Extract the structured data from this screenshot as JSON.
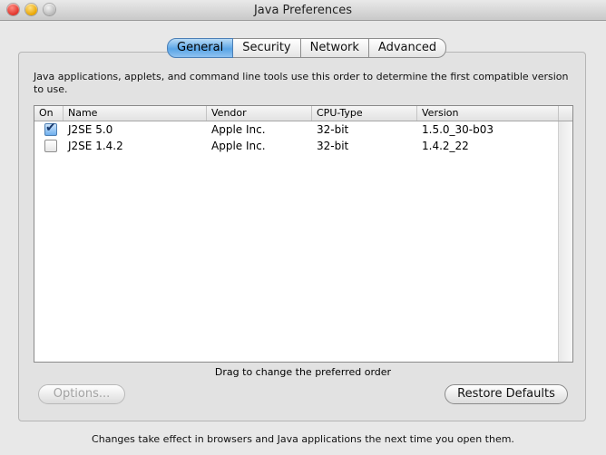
{
  "window": {
    "title": "Java Preferences"
  },
  "tabs": [
    {
      "label": "General",
      "active": true
    },
    {
      "label": "Security",
      "active": false
    },
    {
      "label": "Network",
      "active": false
    },
    {
      "label": "Advanced",
      "active": false
    }
  ],
  "description": "Java applications, applets, and command line tools use this order to determine the first compatible version to use.",
  "table": {
    "columns": [
      "On",
      "Name",
      "Vendor",
      "CPU-Type",
      "Version"
    ],
    "rows": [
      {
        "on": true,
        "name": "J2SE 5.0",
        "vendor": "Apple Inc.",
        "cpu": "32-bit",
        "version": "1.5.0_30-b03"
      },
      {
        "on": false,
        "name": "J2SE 1.4.2",
        "vendor": "Apple Inc.",
        "cpu": "32-bit",
        "version": "1.4.2_22"
      }
    ]
  },
  "hint": "Drag to change the preferred order",
  "buttons": {
    "options": "Options...",
    "restore": "Restore Defaults"
  },
  "footer": "Changes take effect in browsers and Java applications the next time you open them.",
  "icons": {
    "close": "close-icon",
    "minimize": "minimize-icon",
    "zoom": "zoom-icon",
    "checkbox_checked": "checkmark-icon"
  }
}
